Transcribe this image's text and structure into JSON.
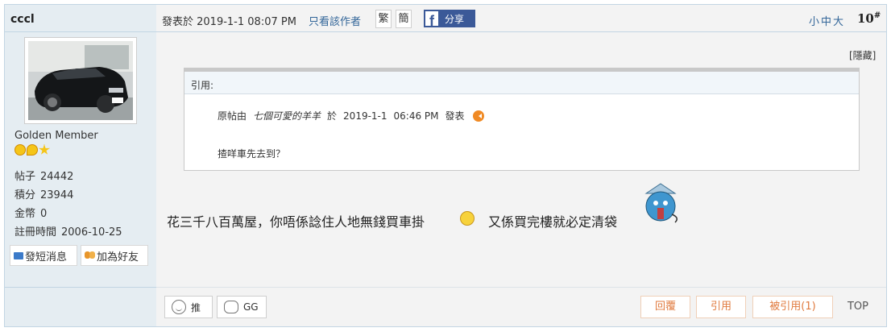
{
  "user": {
    "name": "cccl",
    "rank": "Golden Member",
    "stats": [
      {
        "label": "帖子",
        "value": "24442"
      },
      {
        "label": "積分",
        "value": "23944"
      },
      {
        "label": "金幣",
        "value": "0"
      },
      {
        "label": "註冊時間",
        "value": "2006-10-25"
      }
    ],
    "pm_label": "發短消息",
    "friend_label": "加為好友"
  },
  "header": {
    "posted": "發表於 2019-1-1 08:07 PM",
    "only_author": "只看該作者",
    "trad": "繁",
    "simp": "簡",
    "share": "分享",
    "font_size": "小中大",
    "floor": "10",
    "floor_suffix": "#"
  },
  "post": {
    "hide": "[隱藏]",
    "quote_title": "引用:",
    "quote_prefix": "原帖由",
    "quote_author": "七個可愛的羊羊",
    "quote_on": "於",
    "quote_date": "2019-1-1",
    "quote_time": "06:46 PM",
    "quote_posted": "發表",
    "quote_text": "揸咩車先去到？",
    "body_1": "花三千八百萬屋，你唔係諗住人地無錢買車掛",
    "body_2": "又係買完樓就必定清袋"
  },
  "footer": {
    "push": "推",
    "gg": "GG",
    "reply": "回覆",
    "cite": "引用",
    "cited": "被引用(1)",
    "top": "TOP"
  },
  "colors": {
    "accent": "#336699",
    "action_orange": "#e07a3e",
    "facebook": "#3b5998",
    "sidebar_bg": "#e5edf2"
  }
}
